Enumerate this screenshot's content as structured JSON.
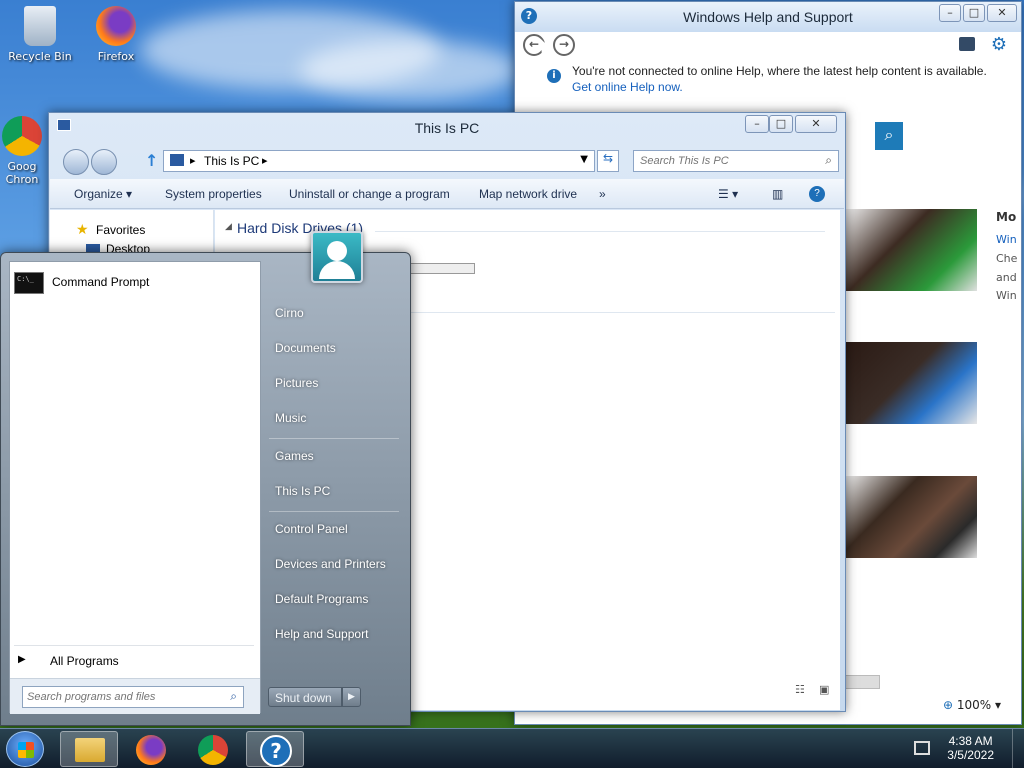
{
  "desktop": {
    "icons": [
      {
        "label": "Recycle Bin",
        "icon": "recycle-bin-icon"
      },
      {
        "label": "Firefox",
        "icon": "firefox-icon"
      },
      {
        "label": "Goog Chron",
        "icon": "chrome-icon"
      }
    ]
  },
  "help_window": {
    "title": "Windows Help and Support",
    "info_text": "You're not connected to online Help, where the latest help content is available.",
    "info_link": "Get online Help now.",
    "side_heading": "Mo",
    "side_lines": [
      "Win",
      "Che",
      "and",
      "Win"
    ],
    "zoom": "100%"
  },
  "explorer": {
    "title": "This Is PC",
    "address": "This Is PC",
    "search_placeholder": "Search This Is PC",
    "toolbar": {
      "organize": "Organize",
      "system_properties": "System properties",
      "uninstall": "Uninstall or change a program",
      "map_drive": "Map network drive",
      "more": "»"
    },
    "nav": {
      "favorites": "Favorites",
      "desktop": "Desktop"
    },
    "section_header": "Hard Disk Drives (1)"
  },
  "start_menu": {
    "programs": [
      {
        "label": "Command Prompt",
        "icon": "cmd-icon"
      }
    ],
    "all_programs": "All Programs",
    "search_placeholder": "Search programs and files",
    "right_items": [
      "Cirno",
      "Documents",
      "Pictures",
      "Music",
      "Games",
      "This Is PC",
      "Control Panel",
      "Devices and Printers",
      "Default Programs",
      "Help and Support"
    ],
    "shutdown": "Shut down"
  },
  "taskbar": {
    "time": "4:38 AM",
    "date": "3/5/2022"
  },
  "colors": {
    "accent": "#1e6fb8",
    "link": "#1560bd"
  }
}
